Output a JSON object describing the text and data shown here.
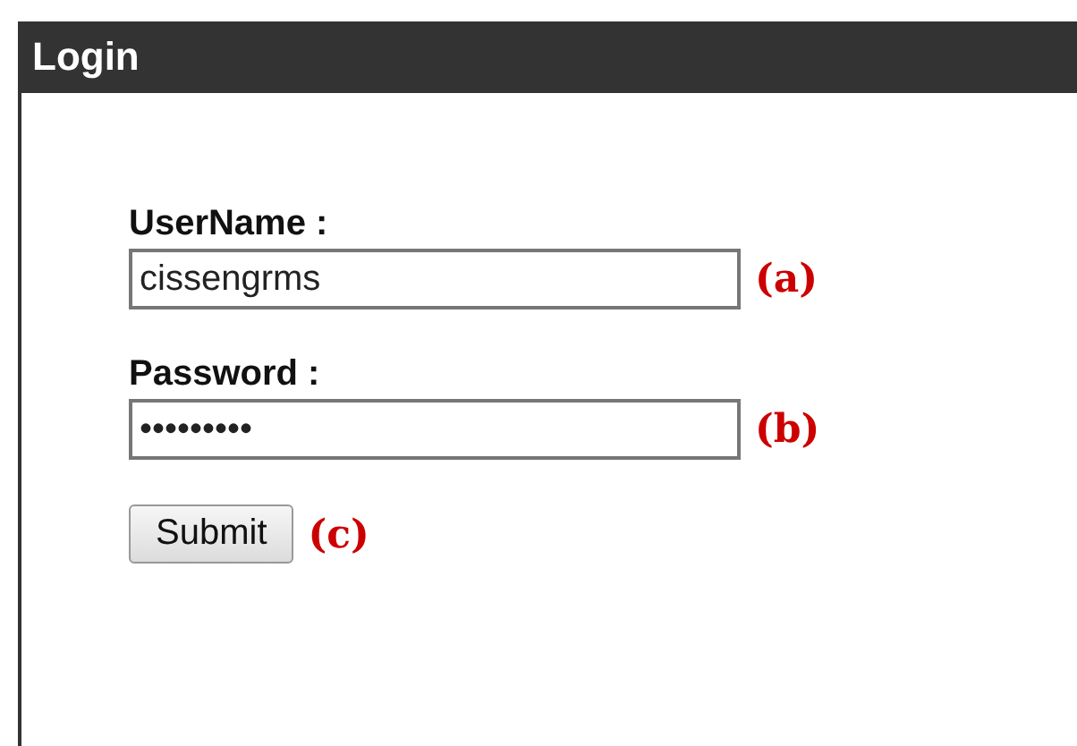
{
  "window": {
    "title": "Login"
  },
  "fields": [
    {
      "label": "UserName :",
      "value": "cissengrms",
      "annotation": "(a)"
    },
    {
      "label": "Password :",
      "value": "•••••••••",
      "annotation": "(b)"
    }
  ],
  "submit": {
    "label": "Submit",
    "annotation": "(c)"
  }
}
